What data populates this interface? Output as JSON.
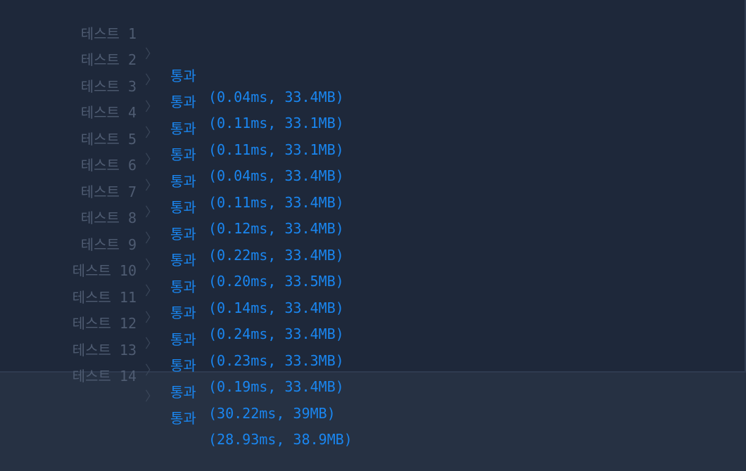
{
  "results": [
    {
      "label": "테스트 1",
      "sep": "〉",
      "status": "통과",
      "detail": "(0.04ms, 33.4MB)"
    },
    {
      "label": "테스트 2",
      "sep": "〉",
      "status": "통과",
      "detail": "(0.11ms, 33.1MB)"
    },
    {
      "label": "테스트 3",
      "sep": "〉",
      "status": "통과",
      "detail": "(0.11ms, 33.1MB)"
    },
    {
      "label": "테스트 4",
      "sep": "〉",
      "status": "통과",
      "detail": "(0.04ms, 33.4MB)"
    },
    {
      "label": "테스트 5",
      "sep": "〉",
      "status": "통과",
      "detail": "(0.11ms, 33.4MB)"
    },
    {
      "label": "테스트 6",
      "sep": "〉",
      "status": "통과",
      "detail": "(0.12ms, 33.4MB)"
    },
    {
      "label": "테스트 7",
      "sep": "〉",
      "status": "통과",
      "detail": "(0.22ms, 33.4MB)"
    },
    {
      "label": "테스트 8",
      "sep": "〉",
      "status": "통과",
      "detail": "(0.20ms, 33.5MB)"
    },
    {
      "label": "테스트 9",
      "sep": "〉",
      "status": "통과",
      "detail": "(0.14ms, 33.4MB)"
    },
    {
      "label": "테스트 10",
      "sep": "〉",
      "status": "통과",
      "detail": "(0.24ms, 33.4MB)"
    },
    {
      "label": "테스트 11",
      "sep": "〉",
      "status": "통과",
      "detail": "(0.23ms, 33.3MB)"
    },
    {
      "label": "테스트 12",
      "sep": "〉",
      "status": "통과",
      "detail": "(0.19ms, 33.4MB)"
    },
    {
      "label": "테스트 13",
      "sep": "〉",
      "status": "통과",
      "detail": "(30.22ms, 39MB)"
    },
    {
      "label": "테스트 14",
      "sep": "〉",
      "status": "통과",
      "detail": "(28.93ms, 38.9MB)"
    }
  ],
  "colors": {
    "background": "#1e283a",
    "label": "#4f5c72",
    "pass": "#1a86f0"
  }
}
